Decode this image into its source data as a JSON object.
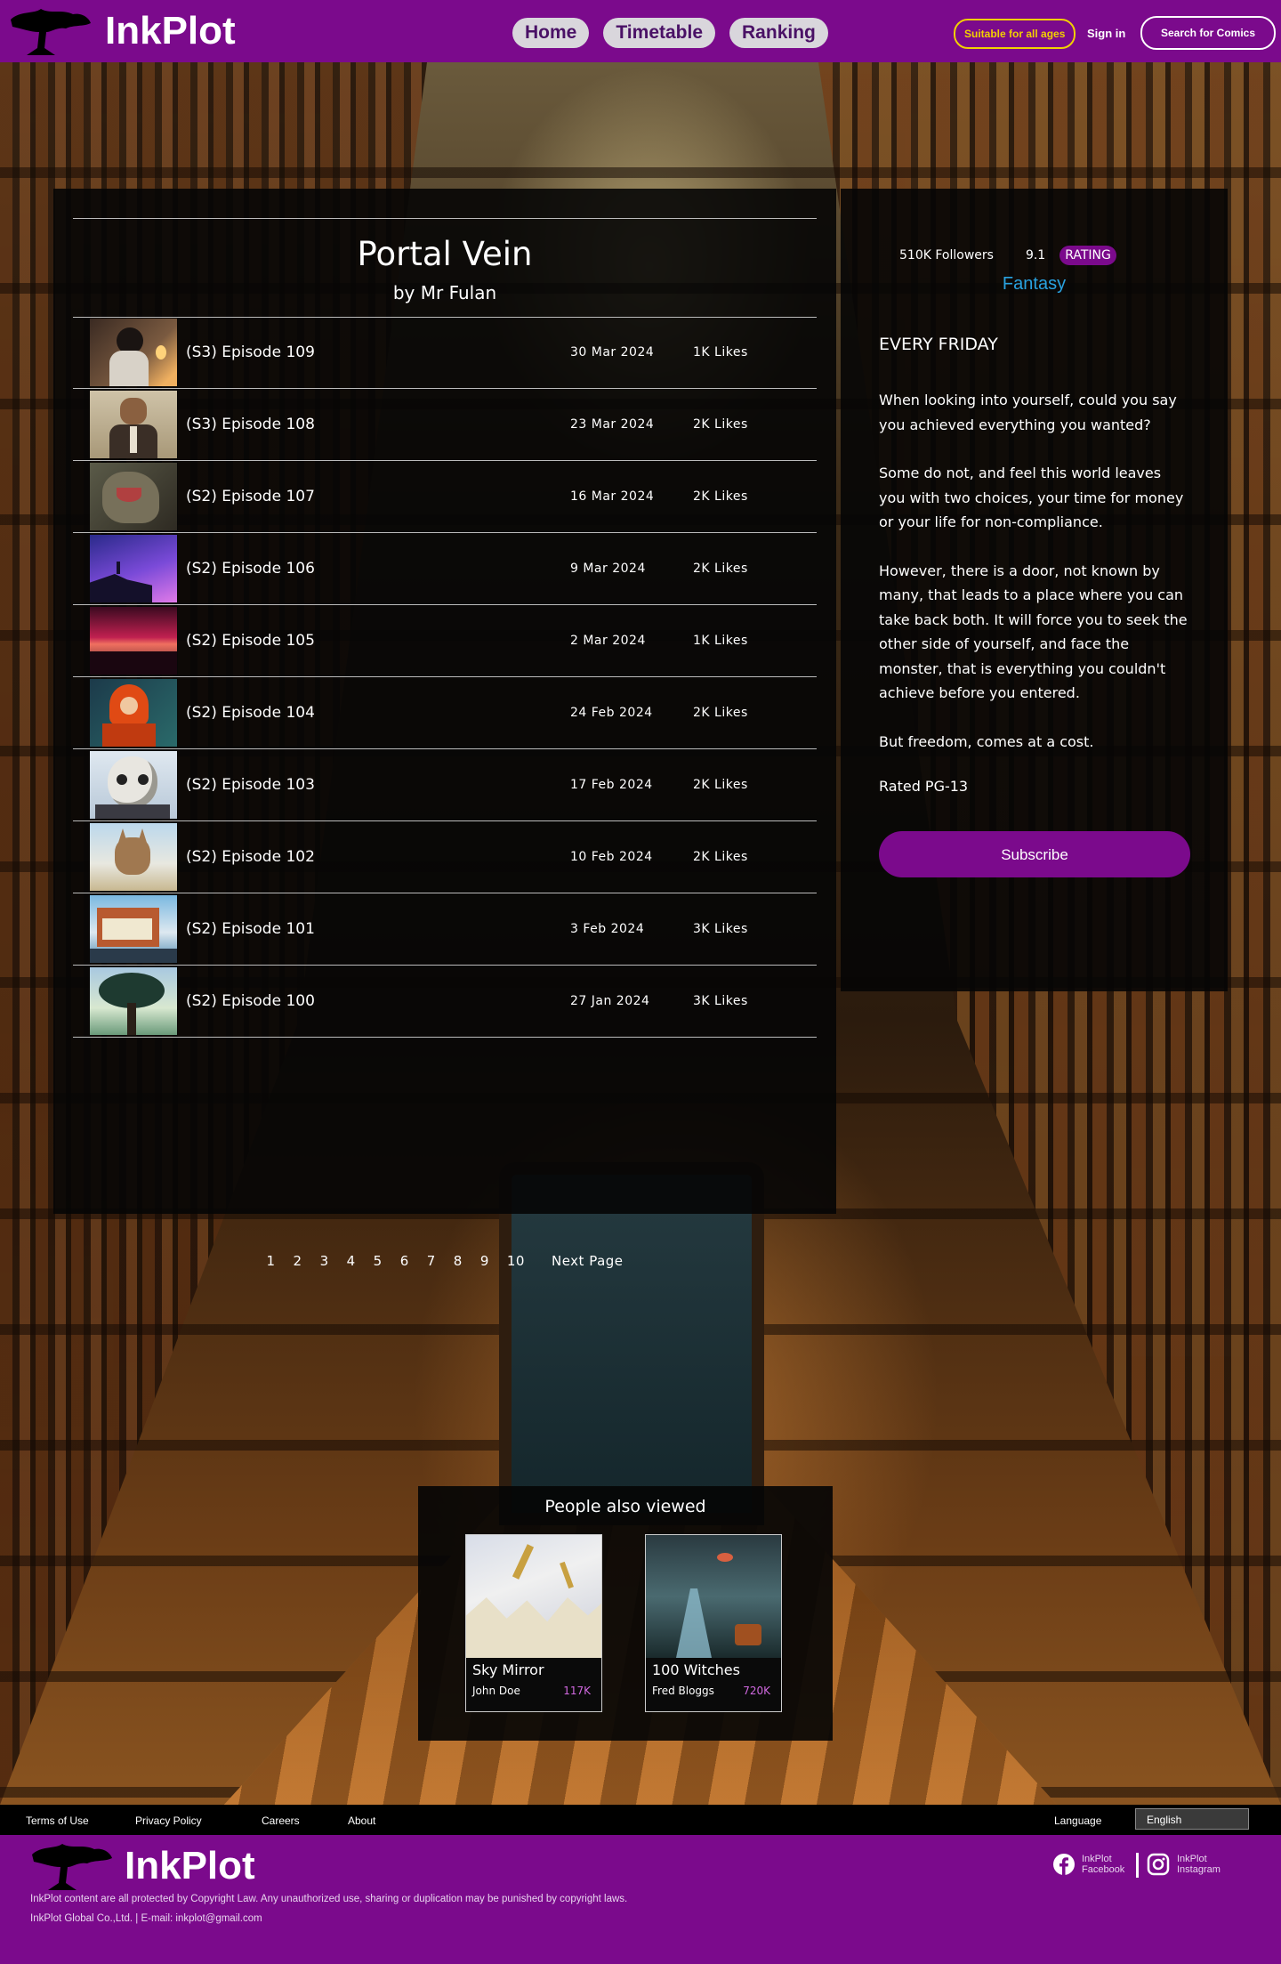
{
  "brand": {
    "name": "InkPlot"
  },
  "header": {
    "nav": [
      "Home",
      "Timetable",
      "Ranking"
    ],
    "age_badge": "Suitable for all ages",
    "signin": "Sign in",
    "search": "Search for Comics"
  },
  "series": {
    "title": "Portal Vein",
    "author": "by Mr Fulan",
    "followers": "510K Followers",
    "score": "9.1",
    "rating_label": "RATING",
    "genre": "Fantasy",
    "schedule": "EVERY FRIDAY",
    "description": [
      "When looking into yourself, could you say you achieved everything you wanted?",
      "Some do not, and feel this world leaves you with two choices, your time for money or your life for non-compliance.",
      "However, there is a door, not known by many, that leads to a place where you can take back both. It will force you to seek the other side of yourself, and face the monster, that is everything you couldn't achieve before you entered.",
      "But freedom, comes at a cost."
    ],
    "rated": "Rated PG-13",
    "subscribe": "Subscribe"
  },
  "episodes": [
    {
      "name": "(S3) Episode 109",
      "date": "30 Mar 2024",
      "likes": "1K Likes"
    },
    {
      "name": "(S3) Episode 108",
      "date": "23 Mar 2024",
      "likes": "2K Likes"
    },
    {
      "name": "(S2) Episode 107",
      "date": "16 Mar 2024",
      "likes": "2K Likes"
    },
    {
      "name": "(S2) Episode 106",
      "date": "9 Mar 2024",
      "likes": "2K Likes"
    },
    {
      "name": "(S2) Episode 105",
      "date": "2 Mar 2024",
      "likes": "1K Likes"
    },
    {
      "name": "(S2) Episode 104",
      "date": "24 Feb 2024",
      "likes": "2K Likes"
    },
    {
      "name": "(S2) Episode 103",
      "date": "17 Feb 2024",
      "likes": "2K Likes"
    },
    {
      "name": "(S2) Episode 102",
      "date": "10 Feb 2024",
      "likes": "2K Likes"
    },
    {
      "name": "(S2) Episode 101",
      "date": "3 Feb 2024",
      "likes": "3K Likes"
    },
    {
      "name": "(S2) Episode 100",
      "date": "27 Jan 2024",
      "likes": "3K Likes"
    }
  ],
  "pagination": {
    "pages": [
      "1",
      "2",
      "3",
      "4",
      "5",
      "6",
      "7",
      "8",
      "9",
      "10"
    ],
    "next": "Next Page"
  },
  "also_viewed": {
    "title": "People also viewed",
    "items": [
      {
        "title": "Sky Mirror",
        "author": "John Doe",
        "count": "117K"
      },
      {
        "title": "100 Witches",
        "author": "Fred Bloggs",
        "count": "720K"
      }
    ]
  },
  "footer": {
    "links": [
      "Terms of Use",
      "Privacy Policy",
      "Careers",
      "About"
    ],
    "language_label": "Language",
    "language_value": "English",
    "copyright": "InkPlot content are all protected by Copyright Law. Any unauthorized use, sharing or duplication may be punished by copyright laws.",
    "company": "InkPlot Global Co.,Ltd. | E-mail: inkplot@gmail.com",
    "facebook": [
      "InkPlot",
      "Facebook"
    ],
    "instagram": [
      "InkPlot",
      "Instagram"
    ]
  },
  "colors": {
    "brand_purple": "#7b0a8c",
    "genre_blue": "#29a2e0",
    "age_yellow": "#f2d000"
  }
}
